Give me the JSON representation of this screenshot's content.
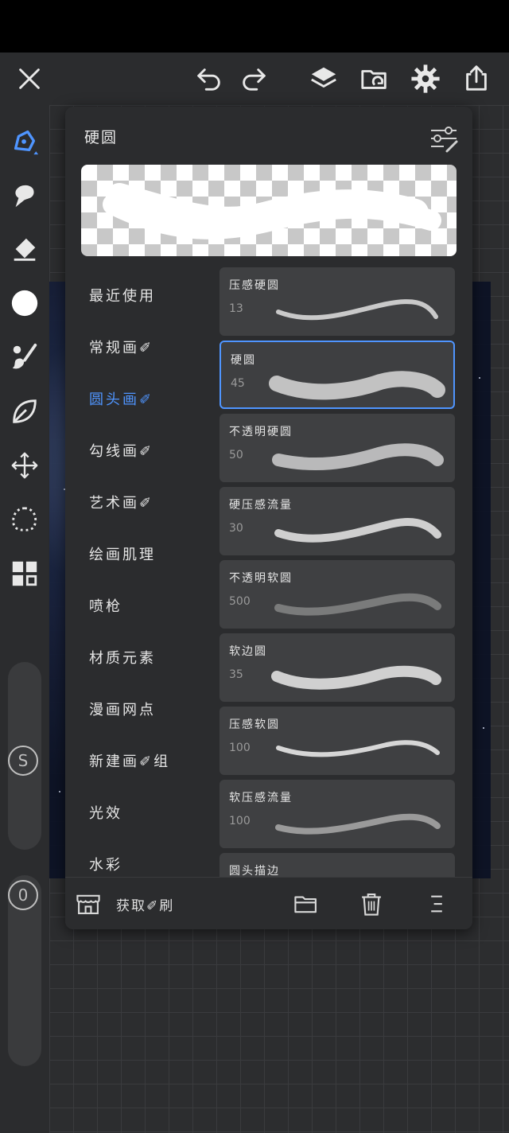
{
  "toolbar": {
    "icons": [
      "close-icon",
      "undo-icon",
      "redo-icon",
      "layers-icon",
      "import-icon",
      "settings-icon",
      "share-icon"
    ]
  },
  "left_toolbar": {
    "tools": [
      "brush-icon",
      "smudge-icon",
      "eraser-icon",
      "color-swatch",
      "brush-picker-icon",
      "lasso-fill-icon",
      "transform-icon",
      "selection-icon",
      "gallery-grid-icon"
    ],
    "size_slider_label": "S",
    "opacity_slider_label": "0",
    "accent_color": "#4f95ff"
  },
  "brush_panel": {
    "title": "硬圆",
    "categories": [
      {
        "label": "最近使用",
        "active": false
      },
      {
        "label": "常规画✐",
        "active": false
      },
      {
        "label": "圆头画✐",
        "active": true
      },
      {
        "label": "勾线画✐",
        "active": false
      },
      {
        "label": "艺术画✐",
        "active": false
      },
      {
        "label": "绘画肌理",
        "active": false
      },
      {
        "label": "喷枪",
        "active": false
      },
      {
        "label": "材质元素",
        "active": false
      },
      {
        "label": "漫画网点",
        "active": false
      },
      {
        "label": "新建画✐组",
        "active": false
      },
      {
        "label": "光效",
        "active": false
      },
      {
        "label": "水彩",
        "active": false
      }
    ],
    "brushes": [
      {
        "name": "压感硬圆",
        "size": "13",
        "selected": false
      },
      {
        "name": "硬圆",
        "size": "45",
        "selected": true
      },
      {
        "name": "不透明硬圆",
        "size": "50",
        "selected": false
      },
      {
        "name": "硬压感流量",
        "size": "30",
        "selected": false
      },
      {
        "name": "不透明软圆",
        "size": "500",
        "selected": false
      },
      {
        "name": "软边圆",
        "size": "35",
        "selected": false
      },
      {
        "name": "压感软圆",
        "size": "100",
        "selected": false
      },
      {
        "name": "软压感流量",
        "size": "100",
        "selected": false
      },
      {
        "name": "圆头描边",
        "size": "",
        "selected": false
      }
    ],
    "footer": {
      "get_brush_label": "获取✐刷"
    }
  }
}
